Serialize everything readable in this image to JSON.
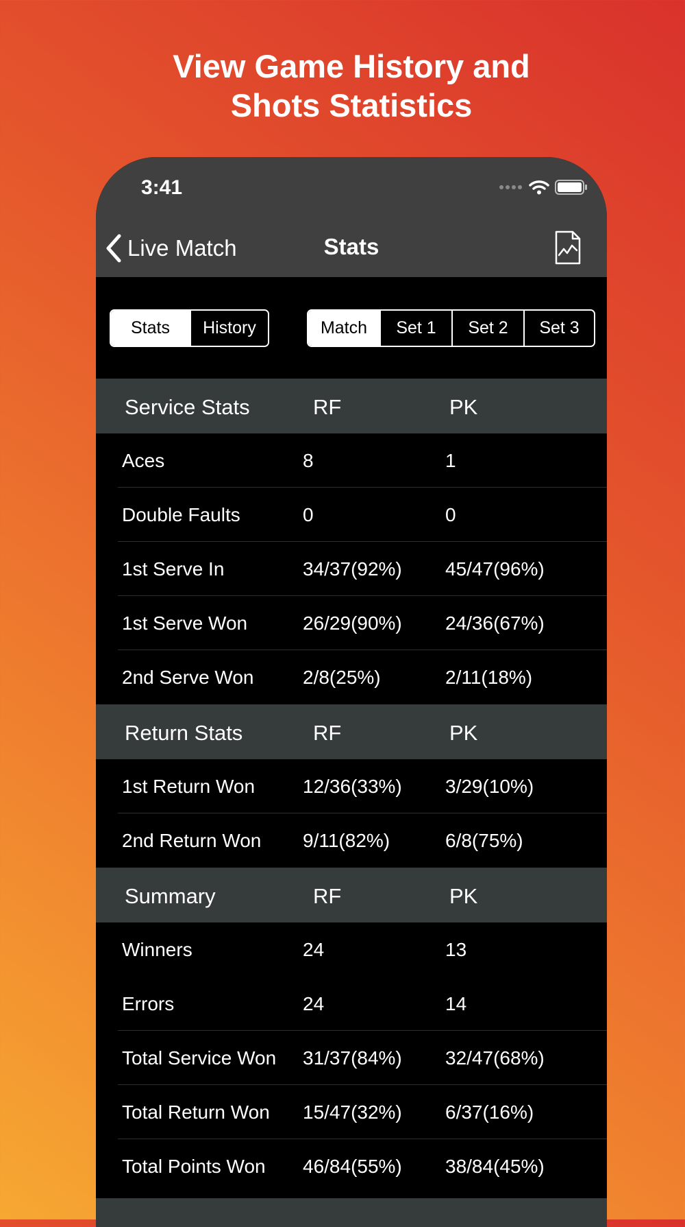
{
  "hero": {
    "line1": "View Game History and",
    "line2": "Shots Statistics"
  },
  "status_bar": {
    "time": "3:41",
    "icons": [
      "signal-dots-icon",
      "wifi-icon",
      "battery-icon"
    ]
  },
  "nav": {
    "back_label": "Live Match",
    "title": "Stats",
    "right_icon": "chart-document-icon"
  },
  "view_toggle": {
    "options": [
      "Stats",
      "History"
    ],
    "selected": "Stats"
  },
  "period_toggle": {
    "options": [
      "Match",
      "Set 1",
      "Set 2",
      "Set 3"
    ],
    "selected": "Match"
  },
  "sections": [
    {
      "title": "Service Stats",
      "player1": "RF",
      "player2": "PK",
      "rows": [
        {
          "label": "Aces",
          "p1": "8",
          "p2": "1"
        },
        {
          "label": "Double Faults",
          "p1": "0",
          "p2": "0"
        },
        {
          "label": "1st Serve In",
          "p1": "34/37(92%)",
          "p2": "45/47(96%)"
        },
        {
          "label": "1st Serve Won",
          "p1": "26/29(90%)",
          "p2": "24/36(67%)"
        },
        {
          "label": "2nd Serve Won",
          "p1": "2/8(25%)",
          "p2": "2/11(18%)"
        }
      ]
    },
    {
      "title": "Return Stats",
      "player1": "RF",
      "player2": "PK",
      "rows": [
        {
          "label": "1st Return Won",
          "p1": "12/36(33%)",
          "p2": "3/29(10%)"
        },
        {
          "label": "2nd Return Won",
          "p1": "9/11(82%)",
          "p2": "6/8(75%)"
        }
      ]
    },
    {
      "title": "Summary",
      "player1": "RF",
      "player2": "PK",
      "rows": [
        {
          "label": "Winners",
          "p1": "24",
          "p2": "13"
        },
        {
          "label": "Errors",
          "p1": "24",
          "p2": "14"
        },
        {
          "label": "Total Service Won",
          "p1": "31/37(84%)",
          "p2": "32/47(68%)"
        },
        {
          "label": "Total Return Won",
          "p1": "15/47(32%)",
          "p2": "6/37(16%)"
        },
        {
          "label": "Total Points Won",
          "p1": "46/84(55%)",
          "p2": "38/84(45%)"
        }
      ]
    }
  ],
  "colors": {
    "background_gradient": [
      "#f6a832",
      "#d9322c"
    ],
    "nav_bar": "#404040",
    "section_header": "#363b3b",
    "table_bg": "#000000",
    "text": "#ffffff"
  }
}
